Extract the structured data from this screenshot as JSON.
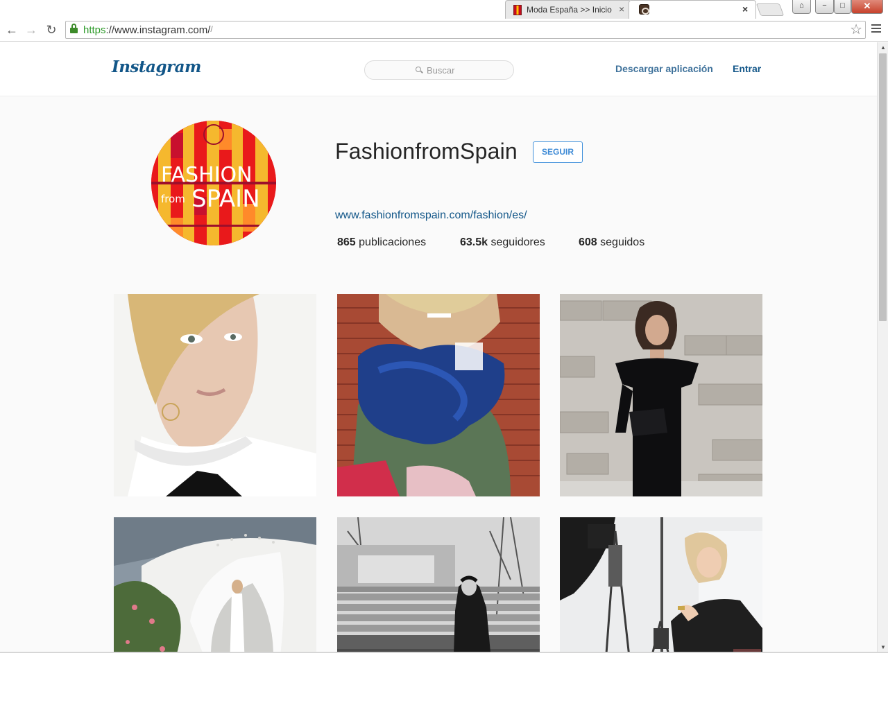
{
  "browser": {
    "tabs": [
      {
        "title": "Moda España >> Inicio",
        "favicon": "spain-flag-icon"
      },
      {
        "title": "",
        "favicon": "instagram-icon"
      }
    ],
    "address_bar": {
      "scheme": "https",
      "rest": "://www.instagram.com/",
      "tail": "/"
    },
    "icons": {
      "back": "←",
      "forward": "→",
      "reload": "↻",
      "star": "☆",
      "close": "×",
      "win_user": "⌂",
      "win_min": "−",
      "win_max": "□",
      "win_close": "✕"
    }
  },
  "header": {
    "logo": "Instagram",
    "search_placeholder": "Buscar",
    "download_app": "Descargar aplicación",
    "login": "Entrar"
  },
  "profile": {
    "username": "FashionfromSpain",
    "follow_label": "SEGUIR",
    "website": "www.fashionfromspain.com/fashion/es/",
    "avatar_logo_text": "FASHION from SPAIN",
    "stats": {
      "posts_count": "865",
      "posts_label": " publicaciones",
      "followers_count": "63.5k",
      "followers_label": " seguidores",
      "following_count": "608",
      "following_label": " seguidos"
    }
  },
  "colors": {
    "link_blue": "#125688",
    "follow_blue": "#4090db",
    "avatar_red": "#e9191b",
    "avatar_yellow": "#f5b82e"
  }
}
